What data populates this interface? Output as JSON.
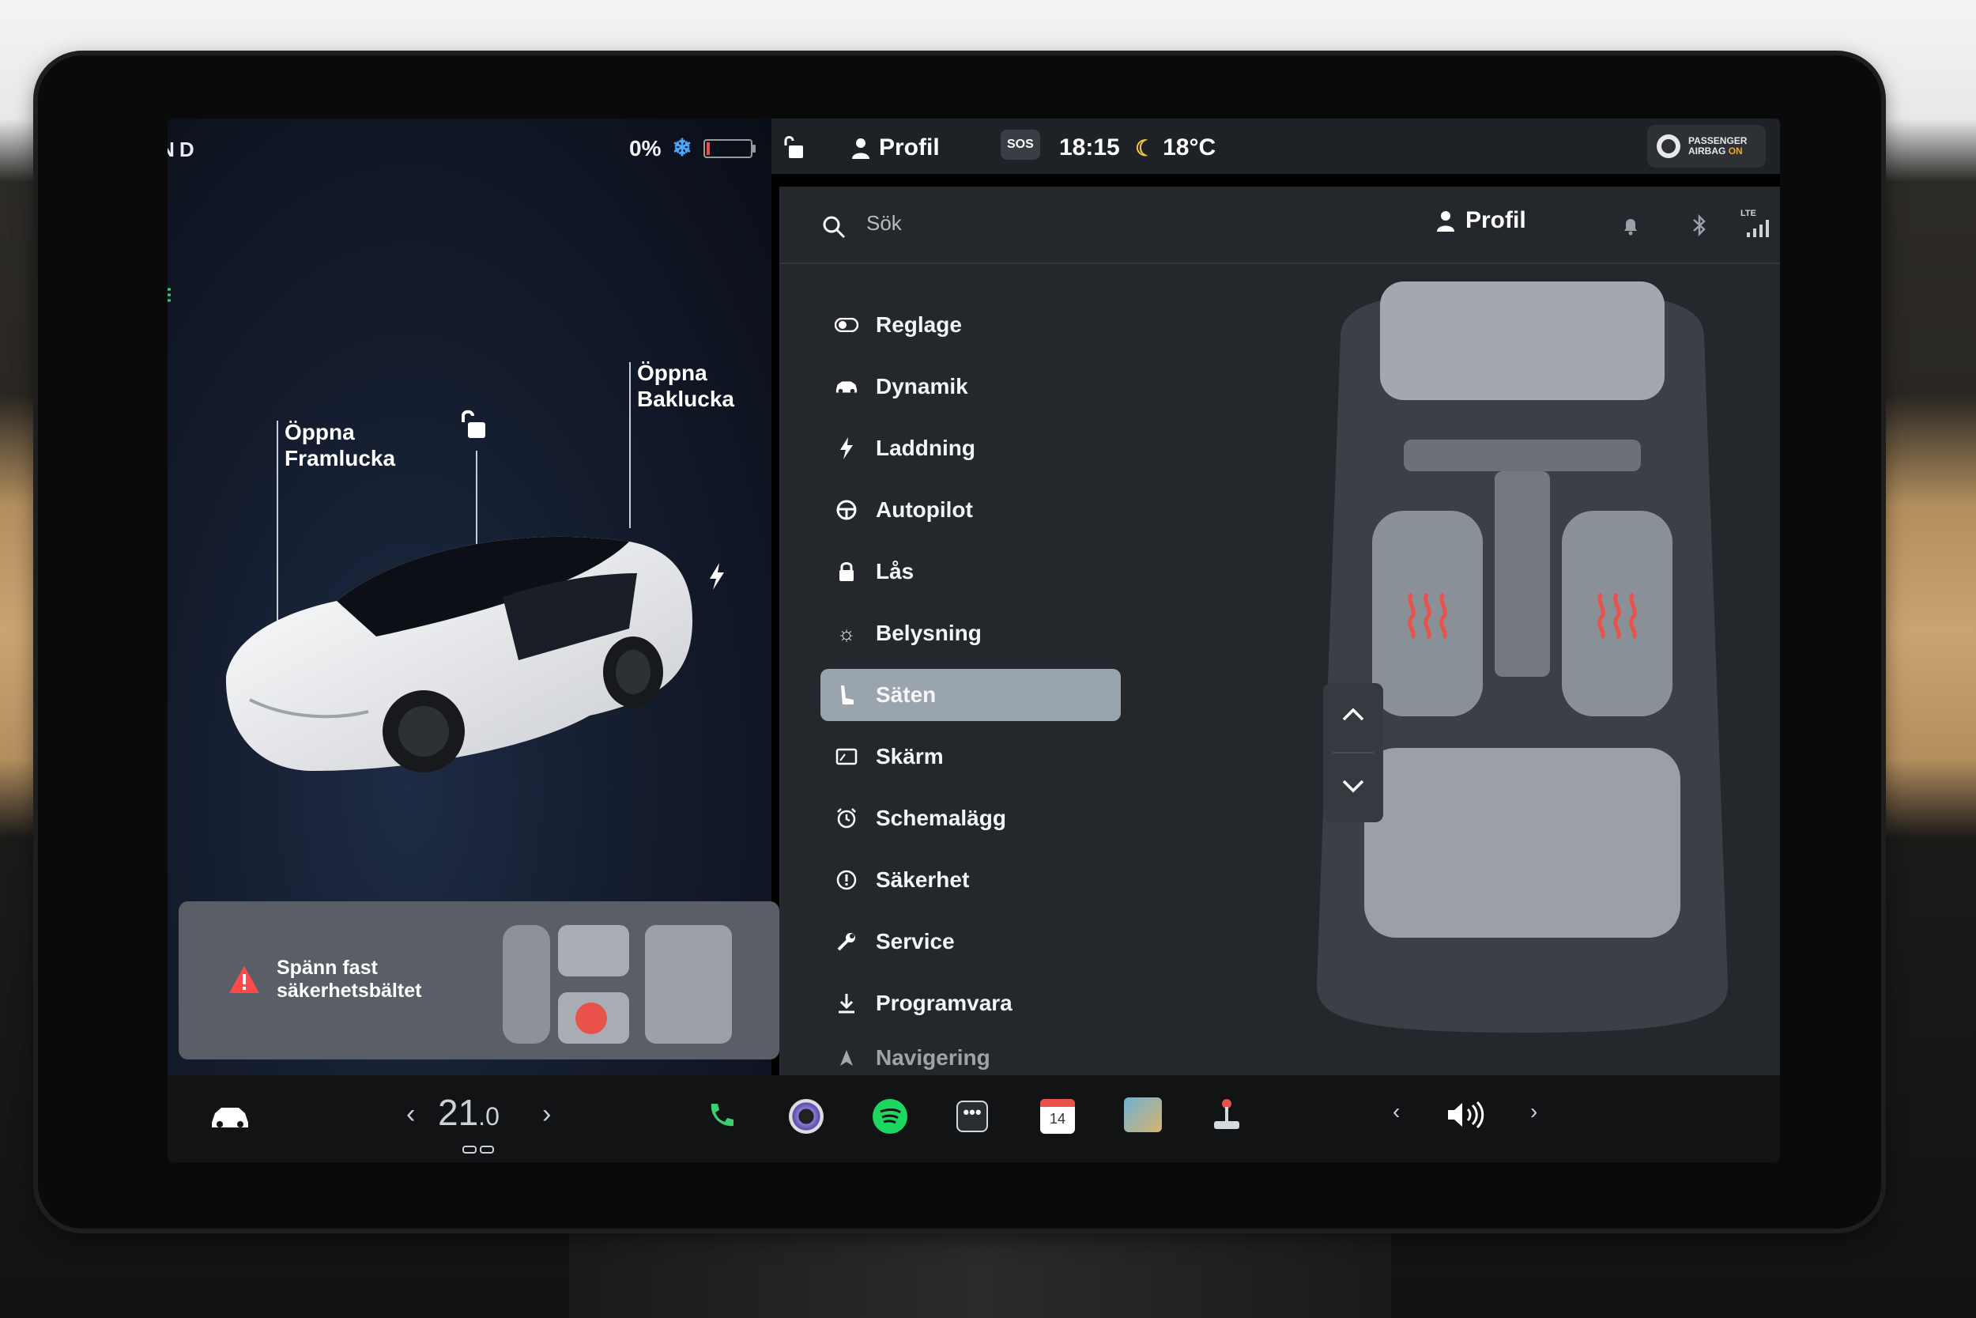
{
  "left_panel": {
    "gear": "PRND",
    "battery_percent": "0%",
    "labels": {
      "front_trunk": "Öppna\nFramlucka",
      "rear_trunk": "Öppna\nBaklucka"
    },
    "alert": "Spänn fast\nsäkerhetsbältet"
  },
  "status_bar": {
    "profile": "Profil",
    "sos": "SOS",
    "time": "18:15",
    "temperature": "18°C",
    "airbag_line1": "PASSENGER",
    "airbag_line2": "AIRBAG",
    "airbag_state": "ON"
  },
  "main": {
    "search_placeholder": "Sök",
    "profile": "Profil",
    "lte": "LTE",
    "menu": [
      {
        "label": "Reglage",
        "icon": "toggle-icon"
      },
      {
        "label": "Dynamik",
        "icon": "car-icon"
      },
      {
        "label": "Laddning",
        "icon": "bolt-icon"
      },
      {
        "label": "Autopilot",
        "icon": "steering-wheel-icon"
      },
      {
        "label": "Lås",
        "icon": "lock-icon"
      },
      {
        "label": "Belysning",
        "icon": "sun-icon"
      },
      {
        "label": "Säten",
        "icon": "seat-icon",
        "selected": true
      },
      {
        "label": "Skärm",
        "icon": "display-icon"
      },
      {
        "label": "Schemalägg",
        "icon": "alarm-icon"
      },
      {
        "label": "Säkerhet",
        "icon": "info-icon"
      },
      {
        "label": "Service",
        "icon": "wrench-icon"
      },
      {
        "label": "Programvara",
        "icon": "download-icon"
      },
      {
        "label": "Navigering",
        "icon": "navigation-icon"
      }
    ]
  },
  "dock": {
    "cabin_temp": "21",
    "cabin_temp_decimal": ".0",
    "calendar_day": "14"
  },
  "colors": {
    "accent_selected": "#9aa4ac",
    "heat": "#e8524a",
    "lights_green": "#3bd16f"
  }
}
